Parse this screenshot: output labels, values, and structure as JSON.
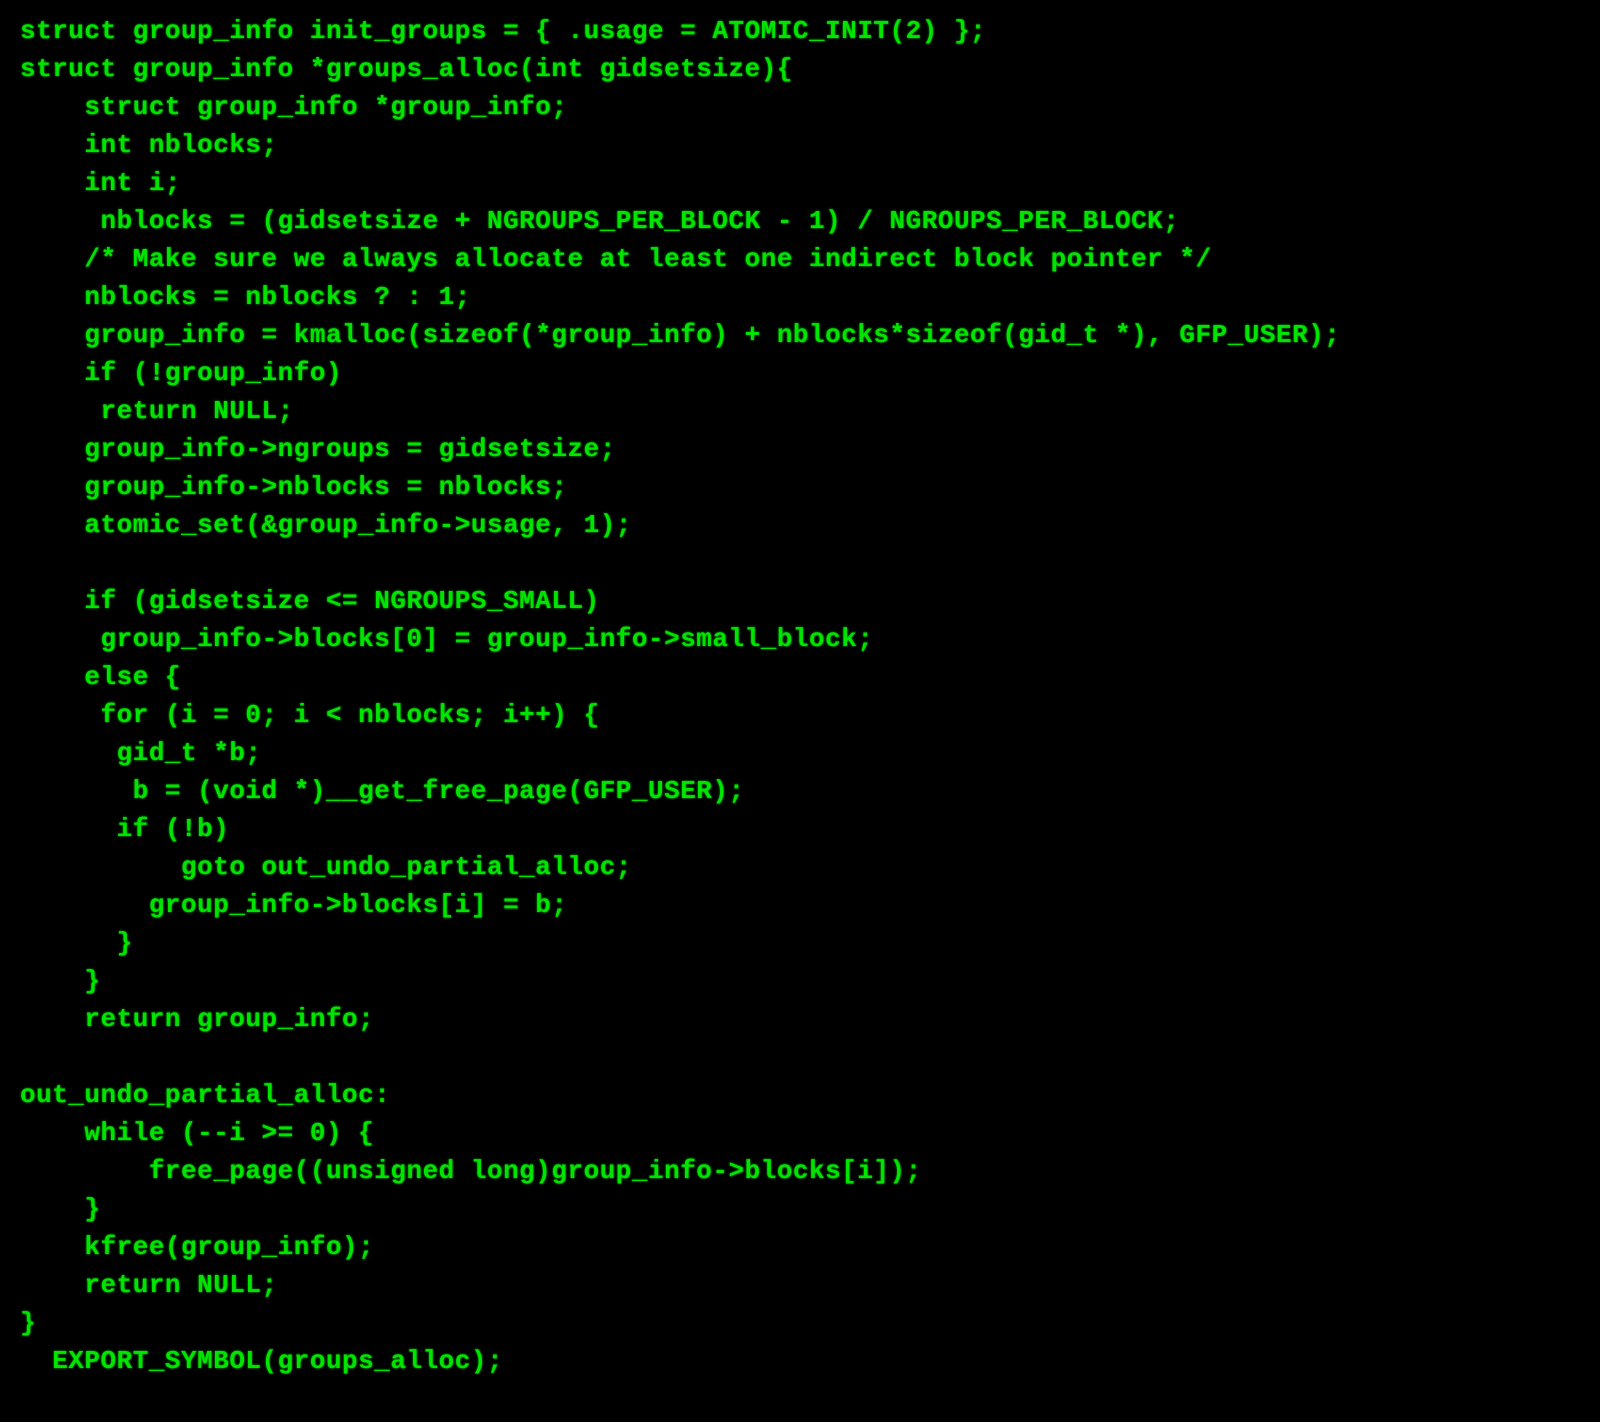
{
  "code": {
    "lines": [
      "struct group_info init_groups = { .usage = ATOMIC_INIT(2) };",
      "struct group_info *groups_alloc(int gidsetsize){",
      "    struct group_info *group_info;",
      "    int nblocks;",
      "    int i;",
      "     nblocks = (gidsetsize + NGROUPS_PER_BLOCK - 1) / NGROUPS_PER_BLOCK;",
      "    /* Make sure we always allocate at least one indirect block pointer */",
      "    nblocks = nblocks ? : 1;",
      "    group_info = kmalloc(sizeof(*group_info) + nblocks*sizeof(gid_t *), GFP_USER);",
      "    if (!group_info)",
      "     return NULL;",
      "    group_info->ngroups = gidsetsize;",
      "    group_info->nblocks = nblocks;",
      "    atomic_set(&group_info->usage, 1);",
      "",
      "    if (gidsetsize <= NGROUPS_SMALL)",
      "     group_info->blocks[0] = group_info->small_block;",
      "    else {",
      "     for (i = 0; i < nblocks; i++) {",
      "      gid_t *b;",
      "       b = (void *)__get_free_page(GFP_USER);",
      "      if (!b)",
      "          goto out_undo_partial_alloc;",
      "        group_info->blocks[i] = b;",
      "      }",
      "    }",
      "    return group_info;",
      "",
      "out_undo_partial_alloc:",
      "    while (--i >= 0) {",
      "        free_page((unsigned long)group_info->blocks[i]);",
      "    }",
      "    kfree(group_info);",
      "    return NULL;",
      "}",
      "  EXPORT_SYMBOL(groups_alloc);"
    ]
  }
}
